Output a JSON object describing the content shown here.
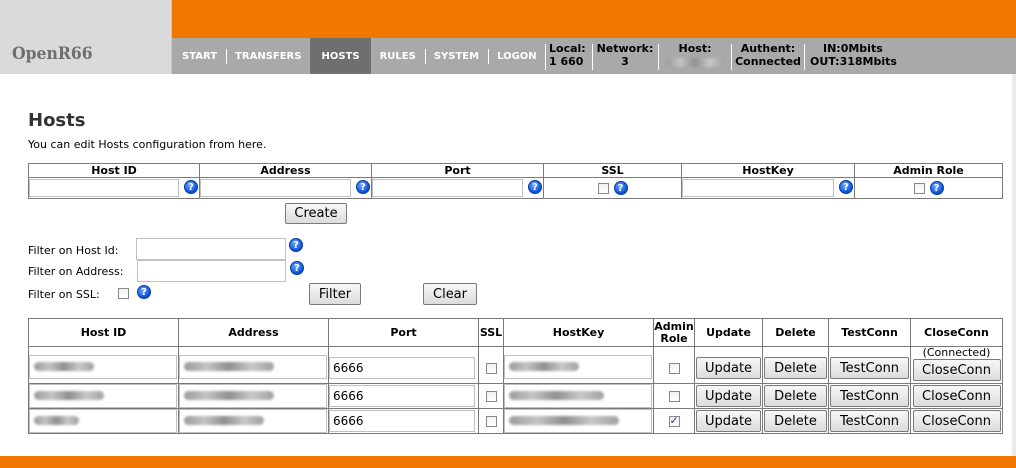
{
  "app": {
    "logo": "OpenR66"
  },
  "nav": {
    "items": [
      {
        "label": "START"
      },
      {
        "label": "TRANSFERS"
      },
      {
        "label": "HOSTS"
      },
      {
        "label": "RULES"
      },
      {
        "label": "SYSTEM"
      },
      {
        "label": "LOGON"
      }
    ],
    "active": "HOSTS"
  },
  "stats": {
    "local_label": "Local:",
    "local_value": "1 660",
    "network_label": "Network:",
    "network_value": "3",
    "host_label": "Host:",
    "authent_label": "Authent:",
    "authent_value": "Connected",
    "in_label": "IN:0Mbits",
    "out_label": "OUT:318Mbits"
  },
  "page": {
    "title": "Hosts",
    "description": "You can edit Hosts configuration from here."
  },
  "create_form": {
    "headers": [
      "Host ID",
      "Address",
      "Port",
      "SSL",
      "HostKey",
      "Admin Role"
    ],
    "help_glyph": "?",
    "create_label": "Create"
  },
  "filters": {
    "host_id_label": "Filter on Host Id:",
    "address_label": "Filter on Address:",
    "ssl_label": "Filter on SSL:",
    "filter_label": "Filter",
    "clear_label": "Clear"
  },
  "list": {
    "headers": {
      "host_id": "Host ID",
      "address": "Address",
      "port": "Port",
      "ssl": "SSL",
      "hostkey": "HostKey",
      "admin_role": "Admin Role",
      "update": "Update",
      "delete": "Delete",
      "testconn": "TestConn",
      "closeconn": "CloseConn"
    },
    "rows": [
      {
        "port": "6666",
        "ssl": false,
        "admin": false,
        "status": "(Connected)",
        "update": "Update",
        "delete": "Delete",
        "testconn": "TestConn",
        "closeconn": "CloseConn"
      },
      {
        "port": "6666",
        "ssl": false,
        "admin": false,
        "status": "",
        "update": "Update",
        "delete": "Delete",
        "testconn": "TestConn",
        "closeconn": "CloseConn"
      },
      {
        "port": "6666",
        "ssl": false,
        "admin": true,
        "status": "",
        "update": "Update",
        "delete": "Delete",
        "testconn": "TestConn",
        "closeconn": "CloseConn"
      }
    ]
  },
  "colors": {
    "brand_orange": "#f07800",
    "nav_gray": "#a9a9a9",
    "nav_active": "#6f6f6f"
  }
}
